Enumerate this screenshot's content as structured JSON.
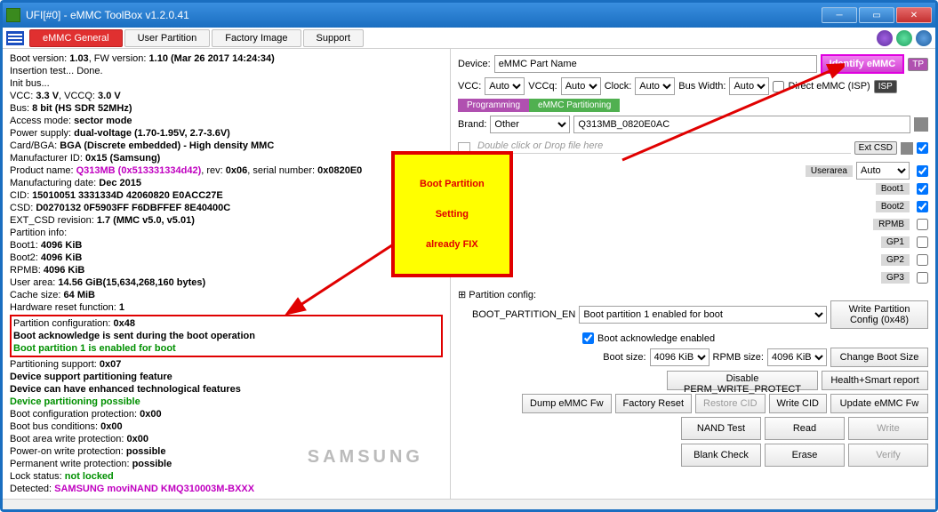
{
  "window": {
    "title": "UFI[#0] - eMMC ToolBox v1.2.0.41"
  },
  "tabs": {
    "general": "eMMC General",
    "user": "User Partition",
    "factory": "Factory Image",
    "support": "Support"
  },
  "log": {
    "l1a": "Boot version: ",
    "l1b": "1.03",
    "l1c": ", FW version: ",
    "l1d": "1.10 (Mar 26 2017 14:24:34)",
    "l2": "Insertion test... Done.",
    "l3": "Init bus...",
    "l4a": "VCC: ",
    "l4b": "3.3 V",
    "l4c": ", VCCQ: ",
    "l4d": "3.0 V",
    "l5a": "Bus: ",
    "l5b": "8 bit (HS SDR 52MHz)",
    "l6a": "Access mode: ",
    "l6b": "sector mode",
    "l7a": "Power supply: ",
    "l7b": "dual-voltage (1.70-1.95V, 2.7-3.6V)",
    "l8a": "Card/BGA: ",
    "l8b": "BGA (Discrete embedded) - High density MMC",
    "l9a": "Manufacturer ID: ",
    "l9b": "0x15 (Samsung)",
    "l10a": "Product name: ",
    "l10b": "Q313MB (0x513331334d42)",
    "l10c": ", rev: ",
    "l10d": "0x06",
    "l10e": ", serial number: ",
    "l10f": "0x0820E0",
    "l11a": "Manufacturing date: ",
    "l11b": "Dec 2015",
    "l12a": "CID: ",
    "l12b": "15010051 3331334D 42060820 E0ACC27E",
    "l13a": "CSD: ",
    "l13b": "D0270132 0F5903FF F6DBFFEF 8E40400C",
    "l14a": "EXT_CSD revision: ",
    "l14b": "1.7 (MMC v5.0, v5.01)",
    "l15": "Partition info:",
    "l16a": " Boot1: ",
    "l16b": "4096 KiB",
    "l17a": " Boot2: ",
    "l17b": "4096 KiB",
    "l18a": " RPMB: ",
    "l18b": "4096 KiB",
    "l19a": " User area: ",
    "l19b": "14.56 GiB(15,634,268,160 bytes)",
    "l20a": "Cache size: ",
    "l20b": "64 MiB",
    "l21a": "Hardware reset function: ",
    "l21b": "1",
    "l22a": "Partition configuration: ",
    "l22b": "0x48",
    "l23": " Boot acknowledge is sent during the boot operation",
    "l24": " Boot partition 1 is enabled for boot",
    "l25a": "Partitioning support: ",
    "l25b": "0x07",
    "l26": " Device support partitioning feature",
    "l27": " Device can have enhanced technological features",
    "l28": " Device partitioning possible",
    "l29a": "Boot configuration protection: ",
    "l29b": "0x00",
    "l30a": "Boot bus conditions: ",
    "l30b": "0x00",
    "l31a": "Boot area write protection: ",
    "l31b": "0x00",
    "l32a": " Power-on write protection: ",
    "l32b": "possible",
    "l33a": " Permanent write protection: ",
    "l33b": "possible",
    "l34a": "Lock status: ",
    "l34b": "not locked",
    "l35a": "Detected: ",
    "l35b": "SAMSUNG moviNAND KMQ310003M-BXXX",
    "watermark": "SAMSUNG"
  },
  "right": {
    "device_lbl": "Device:",
    "device": "eMMC Part Name",
    "identify": "Identify eMMC",
    "tp": "TP",
    "vcc_lbl": "VCC:",
    "vcc": "Auto",
    "vccq_lbl": "VCCq:",
    "vccq": "Auto",
    "clock_lbl": "Clock:",
    "clock": "Auto",
    "bus_lbl": "Bus Width:",
    "bus": "Auto",
    "direct": "Direct eMMC (ISP)",
    "isp": "ISP",
    "sub1": "Programming",
    "sub2": "eMMC Partitioning",
    "brand_lbl": "Brand:",
    "brand": "Other",
    "model": "Q313MB_0820E0AC",
    "filedrop": "Double click or Drop file here",
    "extcsd": "Ext CSD",
    "userarea": "Userarea",
    "auto": "Auto",
    "boot1": "Boot1",
    "boot2": "Boot2",
    "rpmb": "RPMB",
    "gp1": "GP1",
    "gp2": "GP2",
    "gp3": "GP3",
    "partcfg": "Partition config:",
    "booten_lbl": "BOOT_PARTITION_EN",
    "booten": "Boot partition 1 enabled for boot",
    "bootack": "Boot acknowledge enabled",
    "writepart": "Write Partition Config (0x48)",
    "bootsize_lbl": "Boot size:",
    "bootsize": "4096 KiB",
    "rpmbsize_lbl": "RPMB size:",
    "rpmbsize": "4096 KiB",
    "changeboot": "Change Boot Size",
    "disperm": "Disable PERM_WRITE_PROTECT",
    "health": "Health+Smart report",
    "dumpfw": "Dump eMMC Fw",
    "freset": "Factory Reset",
    "rcid": "Restore CID",
    "wcid": "Write CID",
    "updfw": "Update eMMC Fw",
    "nand": "NAND Test",
    "read": "Read",
    "write": "Write",
    "blank": "Blank Check",
    "erase": "Erase",
    "verify": "Verify"
  },
  "annot": {
    "l1": "Boot Partition",
    "l2": "Setting",
    "l3": "already FIX"
  }
}
